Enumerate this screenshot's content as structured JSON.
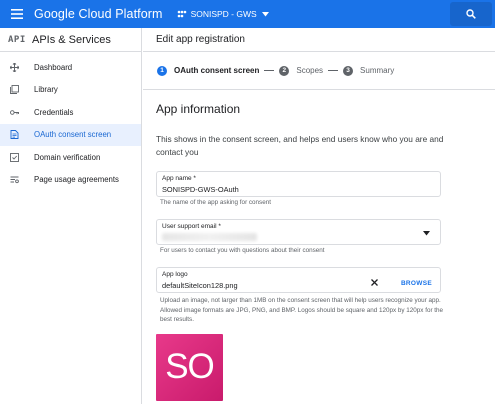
{
  "topbar": {
    "brand": "Google Cloud Platform",
    "project": "SONISPD - GWS",
    "color": "#1a73e8"
  },
  "sidebar": {
    "api_badge": "API",
    "title": "APIs & Services",
    "items": [
      {
        "label": "Dashboard",
        "icon": "dashboard-icon"
      },
      {
        "label": "Library",
        "icon": "library-icon"
      },
      {
        "label": "Credentials",
        "icon": "key-icon"
      },
      {
        "label": "OAuth consent screen",
        "icon": "consent-icon",
        "active": true
      },
      {
        "label": "Domain verification",
        "icon": "checkbox-icon"
      },
      {
        "label": "Page usage agreements",
        "icon": "settings-list-icon"
      }
    ]
  },
  "main": {
    "header": "Edit app registration",
    "steps": [
      {
        "num": "1",
        "label": "OAuth consent screen",
        "active": true
      },
      {
        "num": "2",
        "label": "Scopes"
      },
      {
        "num": "3",
        "label": "Summary"
      }
    ],
    "section_title": "App information",
    "intro": "This shows in the consent screen, and helps end users know who you are and contact you",
    "app_name": {
      "label": "App name *",
      "value": "SONISPD-GWS-OAuth",
      "hint": "The name of the app asking for consent"
    },
    "support_email": {
      "label": "User support email *",
      "hint": "For users to contact you with questions about their consent"
    },
    "app_logo": {
      "label": "App logo",
      "value": "defaultSiteIcon128.png",
      "browse": "BROWSE",
      "hint": "Upload an image, not larger than 1MB on the consent screen that will help users recognize your app. Allowed image formats are JPG, PNG, and BMP. Logos should be square and 120px by 120px for the best results.",
      "preview_text": "SO"
    }
  }
}
